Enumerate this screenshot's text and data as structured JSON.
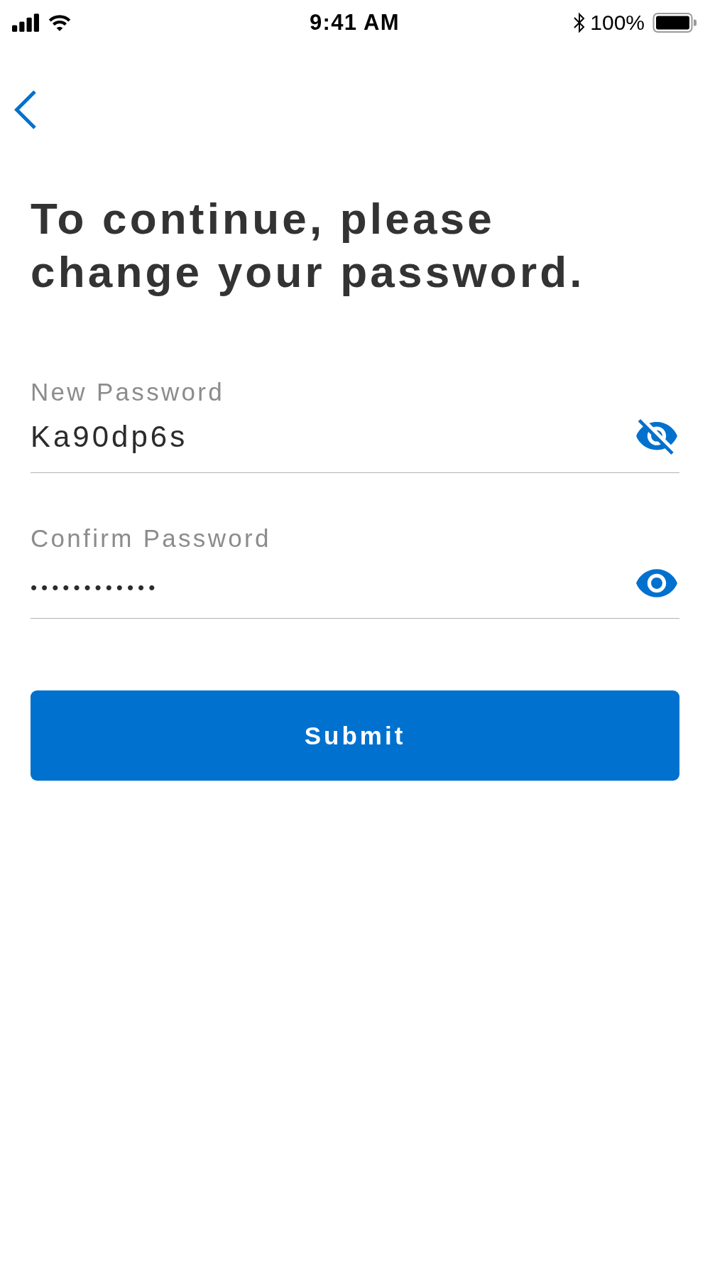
{
  "status_bar": {
    "time": "9:41 AM",
    "battery_percent": "100%"
  },
  "title": "To continue, please change your password.",
  "fields": [
    {
      "label": "New Password",
      "value": "Ka90dp6s",
      "password_visible": true
    },
    {
      "label": "Confirm Password",
      "value": "••••••••••••",
      "password_visible": false
    }
  ],
  "submit_button": {
    "label": "Submit"
  }
}
